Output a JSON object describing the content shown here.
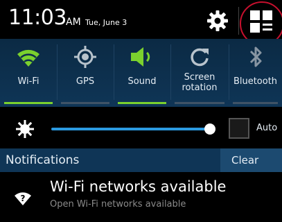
{
  "status_bar": {
    "time": "11:03",
    "ampm": "AM",
    "date": "Tue, June 3",
    "settings_icon": "gear-icon",
    "quick_panel_icon": "grid-toggle-icon"
  },
  "quick_settings": [
    {
      "label": "Wi-Fi",
      "icon": "wifi-icon",
      "on": true
    },
    {
      "label": "GPS",
      "icon": "gps-icon",
      "on": false
    },
    {
      "label": "Sound",
      "icon": "sound-icon",
      "on": true
    },
    {
      "label": "Screen rotation",
      "icon": "rotation-icon",
      "on": false
    },
    {
      "label": "Bluetooth",
      "icon": "bluetooth-icon",
      "on": false
    }
  ],
  "brightness": {
    "level_fraction": 0.97,
    "auto_label": "Auto",
    "auto_checked": false
  },
  "notifications": {
    "title": "Notifications",
    "clear_label": "Clear",
    "items": [
      {
        "title": "Wi-Fi networks available",
        "subtitle": "Open Wi-Fi networks available",
        "icon": "wifi-question-icon"
      }
    ]
  },
  "colors": {
    "accent_on": "#7bd12e",
    "slider_blue": "#2b9ae0",
    "highlight_red": "#c8102e"
  }
}
